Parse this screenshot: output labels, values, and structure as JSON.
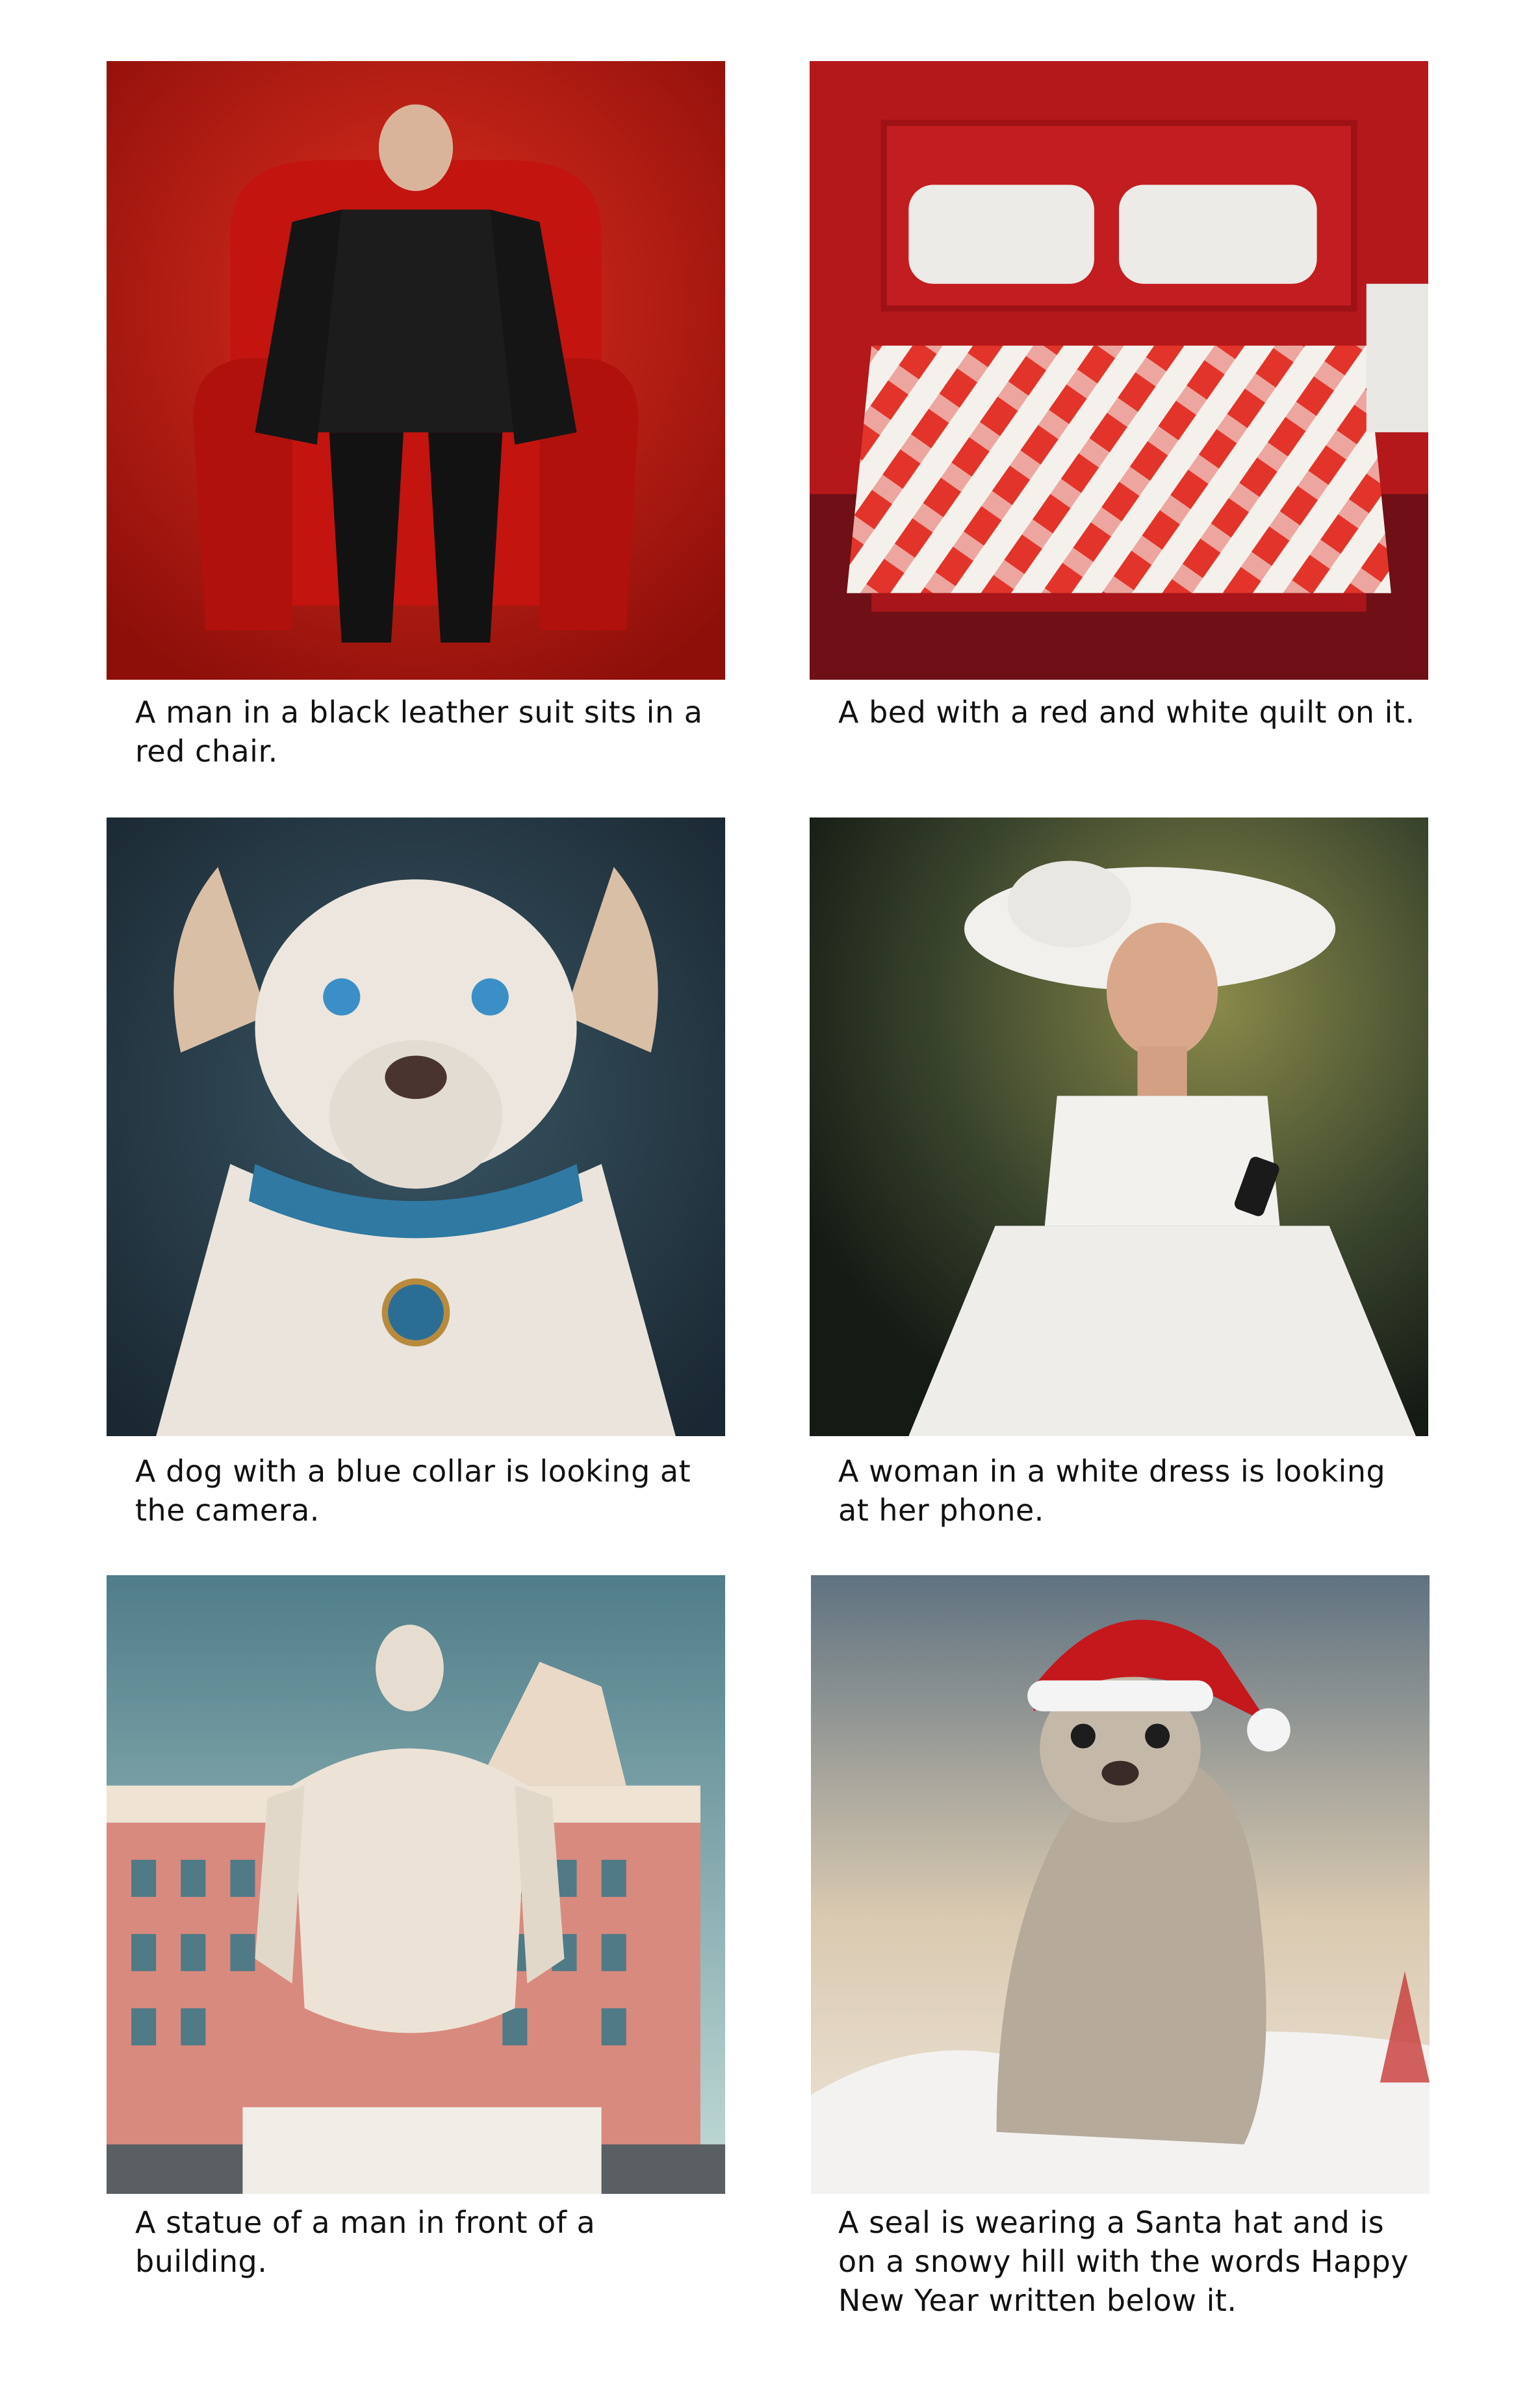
{
  "panels": [
    {
      "id": "man-chair",
      "caption": "A man in a black leather suit sits in a red chair."
    },
    {
      "id": "bed-quilt",
      "caption": "A bed with a red and white quilt on it."
    },
    {
      "id": "dog-collar",
      "caption": "A dog with a blue collar is looking at the camera."
    },
    {
      "id": "woman-phone",
      "caption": "A woman in a white dress is looking at her phone."
    },
    {
      "id": "statue-building",
      "caption": "A statue of a man in front of a building."
    },
    {
      "id": "seal-santa",
      "caption": "A seal is wearing a Santa hat and is on a snowy hill with the words Happy New Year written below it."
    }
  ],
  "colors": {
    "background": "#ffffff",
    "caption_text": "#111111",
    "red_scene": "#c81b14",
    "dog_bg": "#2a3f4c",
    "woman_bg": "#3c4630",
    "statue_sky": "#8fb6bd",
    "seal_sky": "#c9c2b4"
  }
}
